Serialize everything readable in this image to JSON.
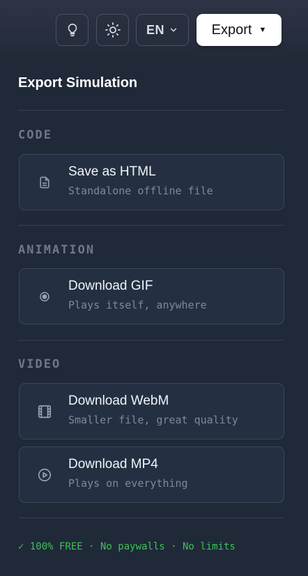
{
  "header": {
    "language": "EN",
    "export_label": "Export",
    "icons": [
      "lightbulb-icon",
      "sun-icon",
      "chevron-down-icon",
      "caret-down-icon"
    ]
  },
  "panel": {
    "title": "Export Simulation",
    "sections": [
      {
        "label": "CODE",
        "items": [
          {
            "title": "Save as HTML",
            "subtitle": "Standalone offline file",
            "icon": "file-icon"
          }
        ]
      },
      {
        "label": "ANIMATION",
        "items": [
          {
            "title": "Download GIF",
            "subtitle": "Plays itself, anywhere",
            "icon": "radio-dot-icon"
          }
        ]
      },
      {
        "label": "VIDEO",
        "items": [
          {
            "title": "Download WebM",
            "subtitle": "Smaller file, great quality",
            "icon": "film-icon"
          },
          {
            "title": "Download MP4",
            "subtitle": "Plays on everything",
            "icon": "play-circle-icon"
          }
        ]
      }
    ],
    "footer": "✓ 100% FREE · No paywalls · No limits"
  },
  "colors": {
    "panel_bg": "#1f2938",
    "card_bg": "#243042",
    "accent_green": "#3fc15a",
    "export_bg": "#ffffff"
  }
}
